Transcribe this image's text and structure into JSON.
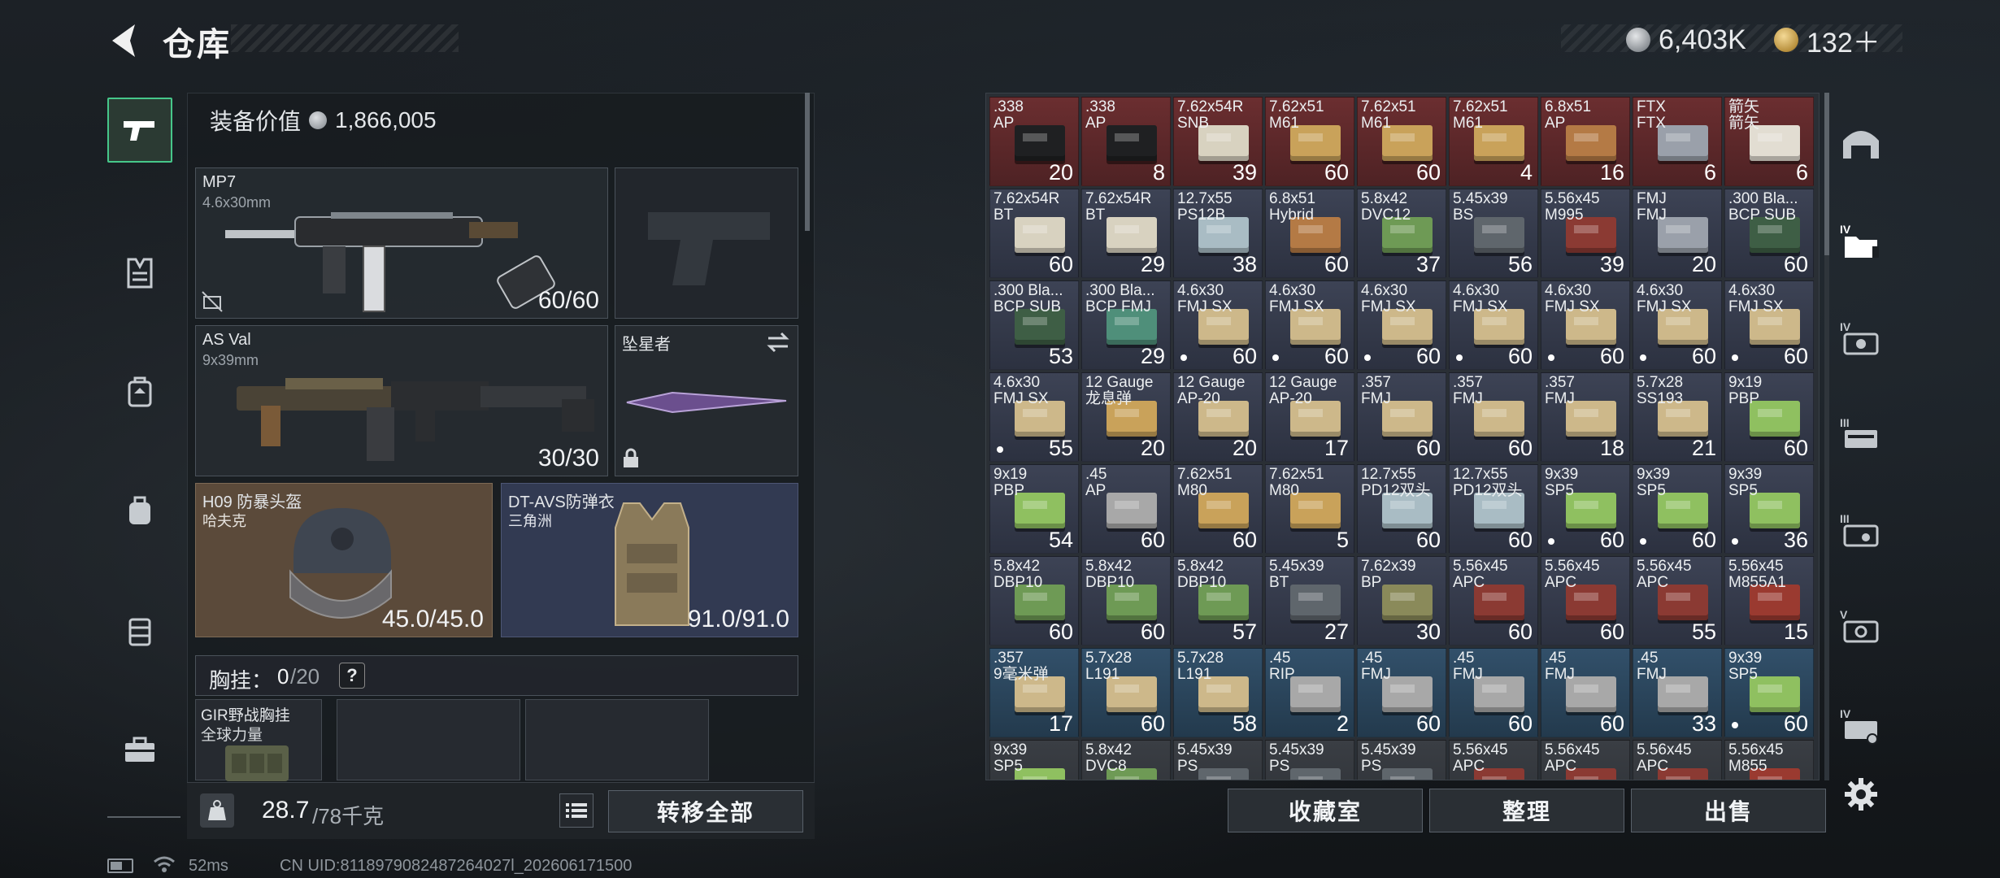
{
  "header": {
    "title": "仓库",
    "currency_silver": "6,403K",
    "currency_gold": "132＋"
  },
  "loadout": {
    "equipment_value_label": "装备价值",
    "equipment_value": "1,866,005",
    "primary": {
      "name": "MP7",
      "caliber": "4.6x30mm",
      "ammo": "60/60"
    },
    "secondary": {
      "name": "AS Val",
      "caliber": "9x39mm",
      "ammo": "30/30"
    },
    "melee": {
      "name": "坠星者"
    },
    "helmet": {
      "name": "H09 防暴头盔",
      "brand": "哈夫克",
      "durability": "45.0/45.0"
    },
    "armor": {
      "name": "DT-AVS防弹衣",
      "brand": "三角洲",
      "durability": "91.0/91.0"
    },
    "chest_rig": {
      "label": "胸挂：",
      "used": "0",
      "total": "/20",
      "help": "?"
    },
    "rig_item": {
      "name": "GIR野战胸挂",
      "brand": "全球力量"
    },
    "weight": {
      "current": "28.7",
      "max": "/78千克"
    },
    "transfer_all": "转移全部"
  },
  "stash_buttons": {
    "collection": "收藏室",
    "sort": "整理",
    "sell": "出售"
  },
  "footer": {
    "ping": "52ms",
    "uid": "CN UID:8118979082487264027l_202606171500"
  },
  "colors": {
    "accent_green": "#46c78a",
    "rarity_red": "#6b2e30",
    "rarity_slate": "#3d4355",
    "rarity_teal": "#32506a",
    "helmet_brown": "#5b4a3a",
    "armor_navy": "#323a52"
  },
  "stash": [
    {
      "cal": ".338",
      "name": "AP",
      "count": "20",
      "bg": "red",
      "box": "#1f2022",
      "dot": false
    },
    {
      "cal": ".338",
      "name": "AP",
      "count": "8",
      "bg": "red",
      "box": "#1f2022",
      "dot": false
    },
    {
      "cal": "7.62x54R",
      "name": "SNB",
      "count": "39",
      "bg": "red",
      "box": "#d8d2c0",
      "dot": false
    },
    {
      "cal": "7.62x51",
      "name": "M61",
      "count": "60",
      "bg": "red",
      "box": "#c9a25a",
      "dot": false
    },
    {
      "cal": "7.62x51",
      "name": "M61",
      "count": "60",
      "bg": "red",
      "box": "#c9a25a",
      "dot": false
    },
    {
      "cal": "7.62x51",
      "name": "M61",
      "count": "4",
      "bg": "red",
      "box": "#c9a25a",
      "dot": false
    },
    {
      "cal": "6.8x51",
      "name": "AP",
      "count": "16",
      "bg": "red",
      "box": "#b47a45",
      "dot": false
    },
    {
      "cal": "FTX",
      "name": "FTX",
      "count": "6",
      "bg": "red",
      "box": "#9aa0aa",
      "dot": false
    },
    {
      "cal": "箭矢",
      "name": "箭矢",
      "count": "6",
      "bg": "red",
      "box": "#e2ddd2",
      "dot": false
    },
    {
      "cal": "7.62x54R",
      "name": "BT",
      "count": "60",
      "bg": "slate",
      "box": "#d8d2c0",
      "dot": false
    },
    {
      "cal": "7.62x54R",
      "name": "BT",
      "count": "29",
      "bg": "slate",
      "box": "#d8d2c0",
      "dot": false
    },
    {
      "cal": "12.7x55",
      "name": "PS12B",
      "count": "38",
      "bg": "slate",
      "box": "#a9bcc4",
      "dot": false
    },
    {
      "cal": "6.8x51",
      "name": "Hybrid",
      "count": "60",
      "bg": "slate",
      "box": "#b47a45",
      "dot": false
    },
    {
      "cal": "5.8x42",
      "name": "DVC12",
      "count": "37",
      "bg": "slate",
      "box": "#6e9a55",
      "dot": false
    },
    {
      "cal": "5.45x39",
      "name": "BS",
      "count": "56",
      "bg": "slate",
      "box": "#5f666c",
      "dot": false
    },
    {
      "cal": "5.56x45",
      "name": "M995",
      "count": "39",
      "bg": "slate",
      "box": "#8b3a33",
      "dot": false
    },
    {
      "cal": "FMJ",
      "name": "FMJ",
      "count": "20",
      "bg": "slate",
      "box": "#9aa0aa",
      "dot": false
    },
    {
      "cal": ".300 Bla...",
      "name": "BCP SUB",
      "count": "60",
      "bg": "slate",
      "box": "#3e5e45",
      "dot": false
    },
    {
      "cal": ".300 Bla...",
      "name": "BCP SUB",
      "count": "53",
      "bg": "slate",
      "box": "#3e5e45",
      "dot": false
    },
    {
      "cal": ".300 Bla...",
      "name": "BCP FMJ",
      "count": "29",
      "bg": "slate",
      "box": "#4f8f7a",
      "dot": false
    },
    {
      "cal": "4.6x30",
      "name": "FMJ SX",
      "count": "60",
      "bg": "slate",
      "box": "#cdb88a",
      "dot": true
    },
    {
      "cal": "4.6x30",
      "name": "FMJ SX",
      "count": "60",
      "bg": "slate",
      "box": "#cdb88a",
      "dot": true
    },
    {
      "cal": "4.6x30",
      "name": "FMJ SX",
      "count": "60",
      "bg": "slate",
      "box": "#cdb88a",
      "dot": true
    },
    {
      "cal": "4.6x30",
      "name": "FMJ SX",
      "count": "60",
      "bg": "slate",
      "box": "#cdb88a",
      "dot": true
    },
    {
      "cal": "4.6x30",
      "name": "FMJ SX",
      "count": "60",
      "bg": "slate",
      "box": "#cdb88a",
      "dot": true
    },
    {
      "cal": "4.6x30",
      "name": "FMJ SX",
      "count": "60",
      "bg": "slate",
      "box": "#cdb88a",
      "dot": true
    },
    {
      "cal": "4.6x30",
      "name": "FMJ SX",
      "count": "60",
      "bg": "slate",
      "box": "#cdb88a",
      "dot": true
    },
    {
      "cal": "4.6x30",
      "name": "FMJ SX",
      "count": "55",
      "bg": "slate",
      "box": "#cdb88a",
      "dot": true
    },
    {
      "cal": "12 Gauge",
      "name": "龙息弹",
      "count": "20",
      "bg": "slate",
      "box": "#c9a25a",
      "dot": false
    },
    {
      "cal": "12 Gauge",
      "name": "AP-20",
      "count": "20",
      "bg": "slate",
      "box": "#cdb88a",
      "dot": false
    },
    {
      "cal": "12 Gauge",
      "name": "AP-20",
      "count": "17",
      "bg": "slate",
      "box": "#cdb88a",
      "dot": false
    },
    {
      "cal": ".357",
      "name": "FMJ",
      "count": "60",
      "bg": "slate",
      "box": "#cdb88a",
      "dot": false
    },
    {
      "cal": ".357",
      "name": "FMJ",
      "count": "60",
      "bg": "slate",
      "box": "#cdb88a",
      "dot": false
    },
    {
      "cal": ".357",
      "name": "FMJ",
      "count": "18",
      "bg": "slate",
      "box": "#cdb88a",
      "dot": false
    },
    {
      "cal": "5.7x28",
      "name": "SS193",
      "count": "21",
      "bg": "slate",
      "box": "#cdb88a",
      "dot": false
    },
    {
      "cal": "9x19",
      "name": "PBP",
      "count": "60",
      "bg": "slate",
      "box": "#8fc060",
      "dot": false
    },
    {
      "cal": "9x19",
      "name": "PBP",
      "count": "54",
      "bg": "slate",
      "box": "#8fc060",
      "dot": false
    },
    {
      "cal": ".45",
      "name": "AP",
      "count": "60",
      "bg": "slate",
      "box": "#a8a8a8",
      "dot": false
    },
    {
      "cal": "7.62x51",
      "name": "M80",
      "count": "60",
      "bg": "slate",
      "box": "#c9a25a",
      "dot": false
    },
    {
      "cal": "7.62x51",
      "name": "M80",
      "count": "5",
      "bg": "slate",
      "box": "#c9a25a",
      "dot": false
    },
    {
      "cal": "12.7x55",
      "name": "PD12双头",
      "count": "60",
      "bg": "slate",
      "box": "#a9bcc4",
      "dot": false
    },
    {
      "cal": "12.7x55",
      "name": "PD12双头",
      "count": "60",
      "bg": "slate",
      "box": "#a9bcc4",
      "dot": false
    },
    {
      "cal": "9x39",
      "name": "SP5",
      "count": "60",
      "bg": "slate",
      "box": "#8fc060",
      "dot": true
    },
    {
      "cal": "9x39",
      "name": "SP5",
      "count": "60",
      "bg": "slate",
      "box": "#8fc060",
      "dot": true
    },
    {
      "cal": "9x39",
      "name": "SP5",
      "count": "36",
      "bg": "slate",
      "box": "#8fc060",
      "dot": true
    },
    {
      "cal": "5.8x42",
      "name": "DBP10",
      "count": "60",
      "bg": "slate",
      "box": "#6e9a55",
      "dot": false
    },
    {
      "cal": "5.8x42",
      "name": "DBP10",
      "count": "60",
      "bg": "slate",
      "box": "#6e9a55",
      "dot": false
    },
    {
      "cal": "5.8x42",
      "name": "DBP10",
      "count": "57",
      "bg": "slate",
      "box": "#6e9a55",
      "dot": false
    },
    {
      "cal": "5.45x39",
      "name": "BT",
      "count": "27",
      "bg": "slate",
      "box": "#5f666c",
      "dot": false
    },
    {
      "cal": "7.62x39",
      "name": "BP",
      "count": "30",
      "bg": "slate",
      "box": "#8a8a5a",
      "dot": false
    },
    {
      "cal": "5.56x45",
      "name": "APC",
      "count": "60",
      "bg": "slate",
      "box": "#8b3a33",
      "dot": false
    },
    {
      "cal": "5.56x45",
      "name": "APC",
      "count": "60",
      "bg": "slate",
      "box": "#8b3a33",
      "dot": false
    },
    {
      "cal": "5.56x45",
      "name": "APC",
      "count": "55",
      "bg": "slate",
      "box": "#8b3a33",
      "dot": false
    },
    {
      "cal": "5.56x45",
      "name": "M855A1",
      "count": "15",
      "bg": "slate",
      "box": "#9a3a30",
      "dot": false
    },
    {
      "cal": ".357",
      "name": "9毫米弹",
      "count": "17",
      "bg": "teal",
      "box": "#cdb88a",
      "dot": false
    },
    {
      "cal": "5.7x28",
      "name": "L191",
      "count": "60",
      "bg": "teal",
      "box": "#cdb88a",
      "dot": false
    },
    {
      "cal": "5.7x28",
      "name": "L191",
      "count": "58",
      "bg": "teal",
      "box": "#cdb88a",
      "dot": false
    },
    {
      "cal": ".45",
      "name": "RIP",
      "count": "2",
      "bg": "teal",
      "box": "#a8a8a8",
      "dot": false
    },
    {
      "cal": ".45",
      "name": "FMJ",
      "count": "60",
      "bg": "teal",
      "box": "#a8a8a8",
      "dot": false
    },
    {
      "cal": ".45",
      "name": "FMJ",
      "count": "60",
      "bg": "teal",
      "box": "#a8a8a8",
      "dot": false
    },
    {
      "cal": ".45",
      "name": "FMJ",
      "count": "60",
      "bg": "teal",
      "box": "#a8a8a8",
      "dot": false
    },
    {
      "cal": ".45",
      "name": "FMJ",
      "count": "33",
      "bg": "teal",
      "box": "#a8a8a8",
      "dot": false
    },
    {
      "cal": "9x39",
      "name": "SP5",
      "count": "60",
      "bg": "teal",
      "box": "#8fc060",
      "dot": true
    },
    {
      "cal": "9x39",
      "name": "SP5",
      "count": "",
      "bg": "gray",
      "box": "#8fc060",
      "dot": false
    },
    {
      "cal": "5.8x42",
      "name": "DVC8",
      "count": "",
      "bg": "gray",
      "box": "#6e9a55",
      "dot": false
    },
    {
      "cal": "5.45x39",
      "name": "PS",
      "count": "",
      "bg": "gray",
      "box": "#5f666c",
      "dot": false
    },
    {
      "cal": "5.45x39",
      "name": "PS",
      "count": "",
      "bg": "gray",
      "box": "#5f666c",
      "dot": false
    },
    {
      "cal": "5.45x39",
      "name": "PS",
      "count": "",
      "bg": "gray",
      "box": "#5f666c",
      "dot": false
    },
    {
      "cal": "5.56x45",
      "name": "APC",
      "count": "",
      "bg": "gray",
      "box": "#8b3a33",
      "dot": false
    },
    {
      "cal": "5.56x45",
      "name": "APC",
      "count": "",
      "bg": "gray",
      "box": "#8b3a33",
      "dot": false
    },
    {
      "cal": "5.56x45",
      "name": "APC",
      "count": "",
      "bg": "gray",
      "box": "#8b3a33",
      "dot": false
    },
    {
      "cal": "5.56x45",
      "name": "M855",
      "count": "",
      "bg": "gray",
      "box": "#9a3a30",
      "dot": false
    }
  ]
}
